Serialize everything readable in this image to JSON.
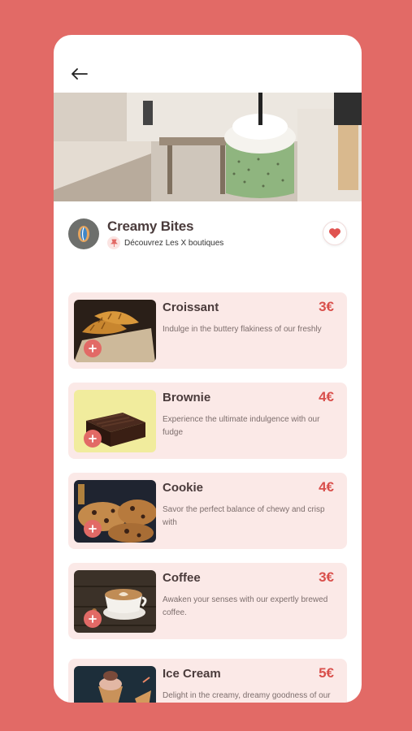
{
  "store": {
    "name": "Creamy Bites",
    "link_text": "Découvrez Les X boutiques"
  },
  "colors": {
    "background": "#e26a66",
    "card": "#fbe9e7",
    "accent": "#d9504c",
    "title": "#4a3b3b"
  },
  "icons": {
    "back": "arrow-left-icon",
    "pin": "pin-icon",
    "favorite": "heart-icon",
    "add": "plus-icon"
  },
  "menu": [
    {
      "name": "Croissant",
      "price": "3€",
      "description": "Indulge in the buttery flakiness of our freshly"
    },
    {
      "name": "Brownie",
      "price": "4€",
      "description": "Experience the ultimate indulgence with our fudge"
    },
    {
      "name": "Cookie",
      "price": "4€",
      "description": "Savor the perfect balance of chewy and crisp with"
    },
    {
      "name": "Coffee",
      "price": "3€",
      "description": "Awaken your senses with our expertly brewed coffee."
    },
    {
      "name": "Ice Cream",
      "price": "5€",
      "description": "Delight in the creamy, dreamy goodness of our"
    }
  ]
}
